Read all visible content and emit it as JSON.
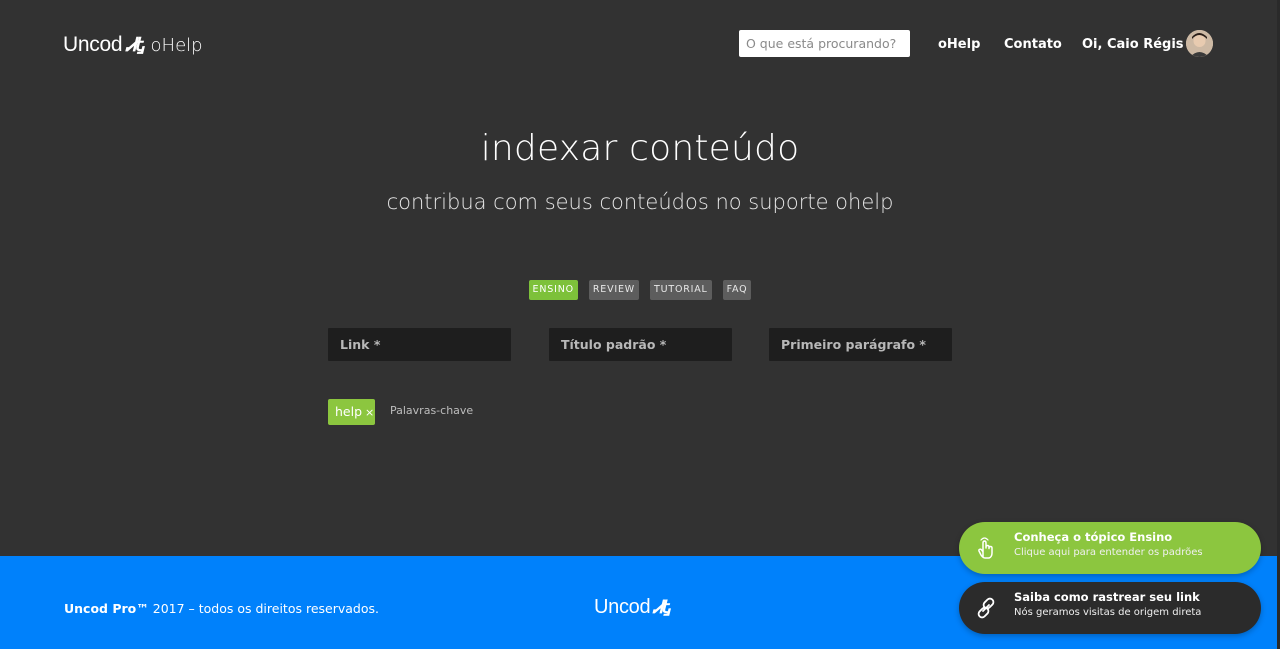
{
  "header": {
    "brand": "Uncod",
    "brand_mark": "ᏗᎿ",
    "brand_sub": "oHelp",
    "search_placeholder": "O que está procurando?",
    "nav": {
      "ohelp": "oHelp",
      "contato": "Contato",
      "greeting": "Oi, Caio Régis"
    }
  },
  "hero": {
    "title": "indexar conteúdo",
    "subtitle": "contribua com seus conteúdos no suporte ohelp"
  },
  "tabs": [
    {
      "label": "ENSINO",
      "active": true
    },
    {
      "label": "REVIEW",
      "active": false
    },
    {
      "label": "TUTORIAL",
      "active": false
    },
    {
      "label": "FAQ",
      "active": false
    }
  ],
  "form": {
    "link_placeholder": "Link *",
    "title_placeholder": "Título padrão *",
    "paragraph_placeholder": "Primeiro parágrafo *",
    "tag_label": "help",
    "tag_remove": "×",
    "keywords_placeholder": "Palavras-chave"
  },
  "footer": {
    "brand_bold": "Uncod Pro™",
    "copy_rest": " 2017 – todos os direitos reservados.",
    "logo": "Uncod",
    "logo_mark": "ᏗᎿ"
  },
  "toasts": {
    "ensino": {
      "title": "Conheça o tópico Ensino",
      "text": "Clique aqui para entender os padrões",
      "icon": "pointer-hand-icon"
    },
    "rastrear": {
      "title": "Saiba como rastrear seu link",
      "text": "Nós geramos visitas de origem direta",
      "icon": "link-icon"
    }
  },
  "colors": {
    "background": "#323232",
    "accent_green": "#8cc63f",
    "footer_blue": "#0081fb",
    "field_bg": "#1e1e1e"
  }
}
